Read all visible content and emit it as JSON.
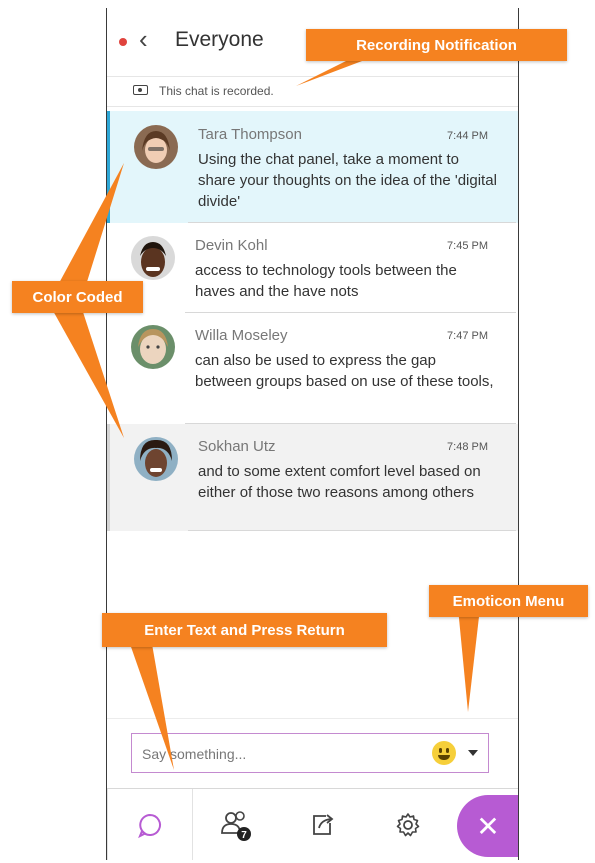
{
  "header": {
    "title": "Everyone",
    "back_icon": "chevron-left-icon",
    "record_dot_color": "#e0433d"
  },
  "recording_bar": {
    "text": "This chat is recorded."
  },
  "messages": [
    {
      "name": "Tara Thompson",
      "time": "7:44 PM",
      "text": "Using the chat panel, take a moment to share your thoughts on the idea of the 'digital divide'"
    },
    {
      "name": "Devin Kohl",
      "time": "7:45 PM",
      "text": "access to technology tools between the haves and the have nots"
    },
    {
      "name": "Willa Moseley",
      "time": "7:47 PM",
      "text": "can also be used to express the gap between groups based on use of these tools,"
    },
    {
      "name": "Sokhan Utz",
      "time": "7:48 PM",
      "text": "and to some extent comfort level based on either of those two reasons among others"
    }
  ],
  "input": {
    "placeholder": "Say something..."
  },
  "tabs": {
    "participants_badge": "7"
  },
  "callouts": {
    "recording": "Recording Notification",
    "color_coded": "Color Coded",
    "emoticon": "Emoticon Menu",
    "enter_text": "Enter Text and Press Return"
  },
  "colors": {
    "accent": "#b75bd3",
    "callout": "#f58220",
    "highlight": "#e3f6fb",
    "highlight_border": "#2ea7d6"
  }
}
